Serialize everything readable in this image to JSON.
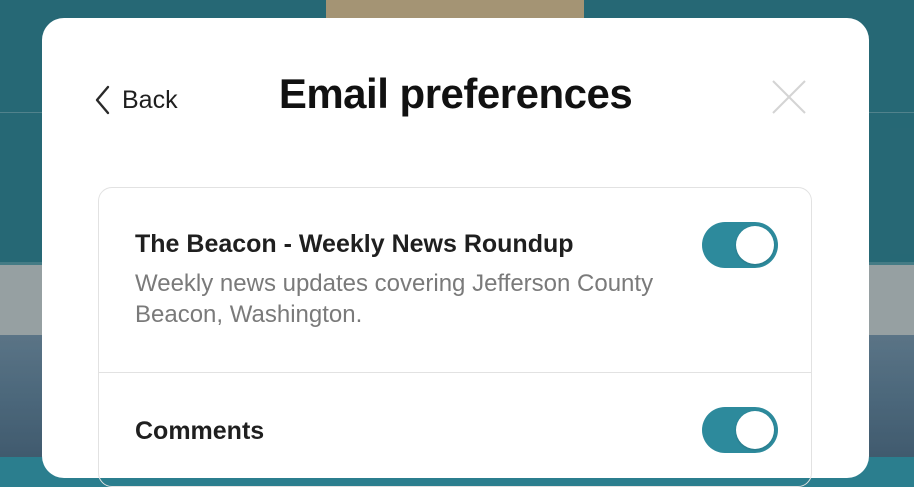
{
  "header": {
    "back_label": "Back",
    "title": "Email preferences",
    "icons": {
      "back": "chevron-left-icon",
      "close": "close-icon"
    }
  },
  "preferences": [
    {
      "title": "The Beacon - Weekly News Roundup",
      "description": "Weekly news updates covering Jefferson County Beacon, Washington.",
      "enabled": true
    },
    {
      "title": "Comments",
      "enabled": true
    }
  ],
  "colors": {
    "toggle_on": "#2d8a9c",
    "background_teal": "#2f7f8f"
  }
}
